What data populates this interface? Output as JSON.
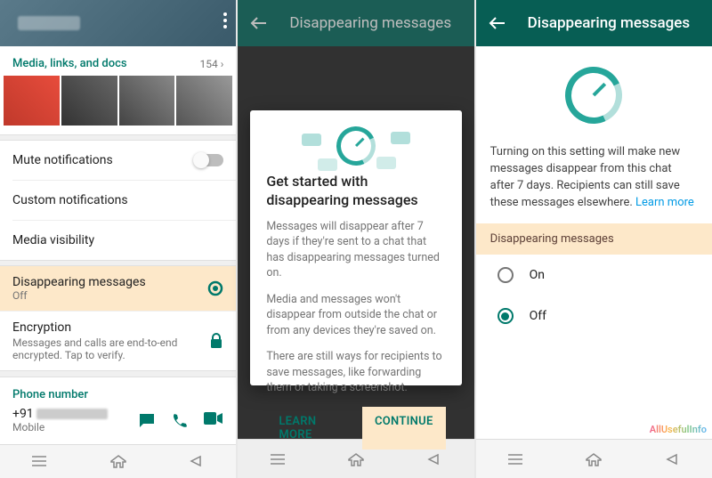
{
  "screen1": {
    "media_section": {
      "title": "Media, links, and docs",
      "count": "154 ›"
    },
    "rows": {
      "mute": "Mute notifications",
      "custom": "Custom notifications",
      "media_vis": "Media visibility",
      "disappearing": {
        "title": "Disappearing messages",
        "sub": "Off"
      },
      "encryption": {
        "title": "Encryption",
        "sub": "Messages and calls are end-to-end encrypted. Tap to verify."
      }
    },
    "phone_section": "Phone number",
    "phone": {
      "prefix": "+91",
      "type": "Mobile"
    }
  },
  "screen2": {
    "header": "Disappearing messages",
    "dialog": {
      "title": "Get started with disappearing messages",
      "p1": "Messages will disappear after 7 days if they're sent to a chat that has disappearing messages turned on.",
      "p2": "Media and messages won't disappear from outside the chat or from any devices they're saved on.",
      "p3": "There are still ways for recipients to save messages, like forwarding them or taking a screenshot.",
      "learn": "LEARN MORE",
      "continue": "CONTINUE"
    }
  },
  "screen3": {
    "header": "Disappearing messages",
    "desc": "Turning on this setting will make new messages disappear from this chat after 7 days. Recipients can still save these messages elsewhere. ",
    "learn": "Learn more",
    "section": "Disappearing messages",
    "on": "On",
    "off": "Off",
    "watermark": "AllUsefulInfo"
  }
}
